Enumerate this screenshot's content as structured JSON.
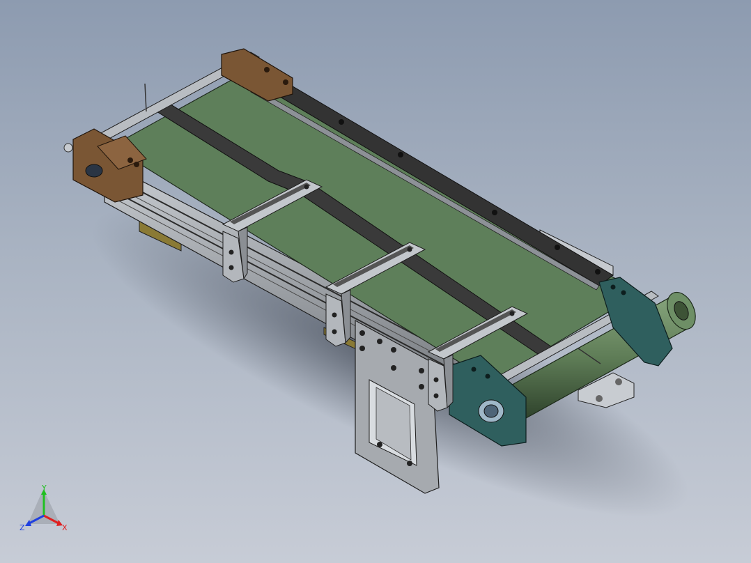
{
  "viewport": {
    "background_top": "#8d9bb0",
    "background_bottom": "#c7ccd6"
  },
  "triad": {
    "x_label": "X",
    "y_label": "Y",
    "z_label": "Z",
    "x_color": "#e02020",
    "y_color": "#20c020",
    "z_color": "#2040e0"
  },
  "model": {
    "belt_color": "#5e7f5a",
    "frame_color": "#a9adb2",
    "rail_color": "#3b3b3b",
    "bearing_brown": "#7a5634",
    "bearing_teal": "#2f5f5e",
    "roller_green": "#5f7d57"
  }
}
